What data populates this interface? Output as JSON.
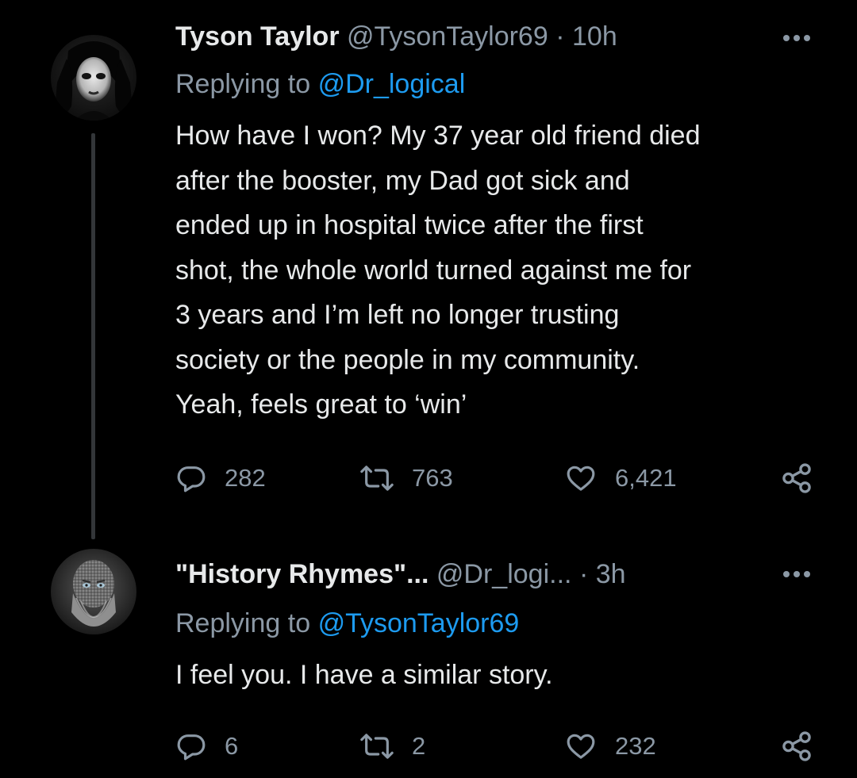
{
  "colors": {
    "background": "#000000",
    "text_primary": "#e7e9ea",
    "text_secondary": "#8b98a5",
    "link": "#1d9bf0",
    "thread_line": "#333639"
  },
  "tweets": [
    {
      "avatar_icon": "user-avatar-pale-face",
      "display_name": "Tyson Taylor",
      "handle": "@TysonTaylor69",
      "separator": "·",
      "time": "10h",
      "replying_prefix": "Replying to",
      "replying_to": "@Dr_logical",
      "text": "How have I won? My 37 year old friend died\nafter the booster, my Dad got sick and\nended up in hospital twice after the first\nshot, the whole world turned against me for\n3 years and I’m left no longer trusting\nsociety or the people in my community.\nYeah, feels great to ‘win’",
      "replies": "282",
      "retweets": "763",
      "likes": "6,421"
    },
    {
      "avatar_icon": "user-avatar-bearded-man",
      "display_name": "\"History Rhymes\"...",
      "handle": "@Dr_logi...",
      "separator": "·",
      "time": "3h",
      "replying_prefix": "Replying to",
      "replying_to": "@TysonTaylor69",
      "text": "I feel you. I have a similar story.",
      "replies": "6",
      "retweets": "2",
      "likes": "232"
    }
  ]
}
